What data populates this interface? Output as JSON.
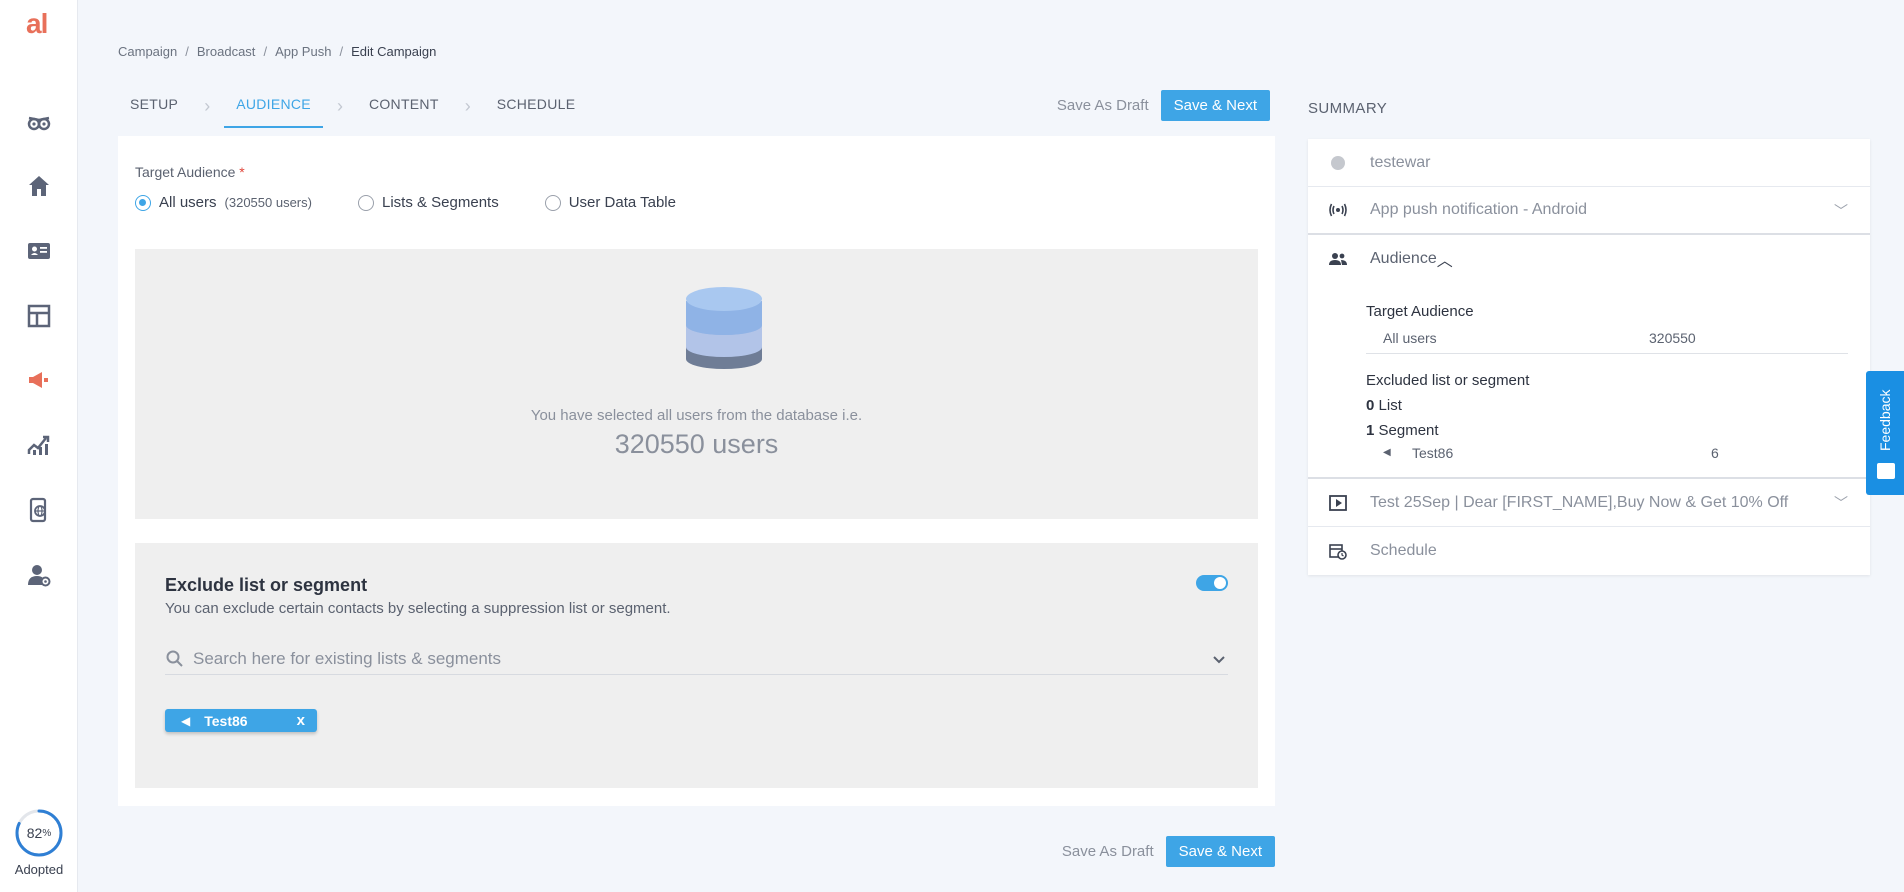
{
  "sidebar": {
    "logo": "al",
    "adoption": {
      "percent": "82",
      "unit": "%",
      "label": "Adopted",
      "fraction": 0.82
    }
  },
  "breadcrumb": [
    "Campaign",
    "Broadcast",
    "App Push",
    "Edit Campaign"
  ],
  "tabs": [
    "SETUP",
    "AUDIENCE",
    "CONTENT",
    "SCHEDULE"
  ],
  "actions": {
    "draft": "Save As Draft",
    "next": "Save & Next"
  },
  "audience": {
    "label": "Target Audience",
    "required": "*",
    "options": [
      {
        "label": "All users",
        "sub": "(320550 users)"
      },
      {
        "label": "Lists & Segments",
        "sub": ""
      },
      {
        "label": "User Data Table",
        "sub": ""
      }
    ],
    "db_text": "You have selected all users from the database i.e.",
    "db_count": "320550 users"
  },
  "exclude": {
    "title": "Exclude list or segment",
    "description": "You can exclude certain contacts by selecting a suppression list or segment.",
    "search_placeholder": "Search here for existing lists & segments",
    "chip": "Test86",
    "chip_remove": "x"
  },
  "summary": {
    "title": "SUMMARY",
    "name": "testewar",
    "channel": "App push notification - Android",
    "audience_title": "Audience",
    "target_heading": "Target Audience",
    "target_key": "All users",
    "target_value": "320550",
    "excluded_heading": "Excluded list or segment",
    "list_count": "0",
    "list_label": "List",
    "segment_count": "1",
    "segment_label": "Segment",
    "segment_name": "Test86",
    "segment_value": "6",
    "content": "Test 25Sep | Dear [FIRST_NAME],Buy Now & Get 10% Off",
    "schedule": "Schedule"
  },
  "feedback": "Feedback",
  "colors": {
    "accent": "#3ea5e6",
    "logo": "#e8705a",
    "feedback": "#1a8fe3"
  }
}
